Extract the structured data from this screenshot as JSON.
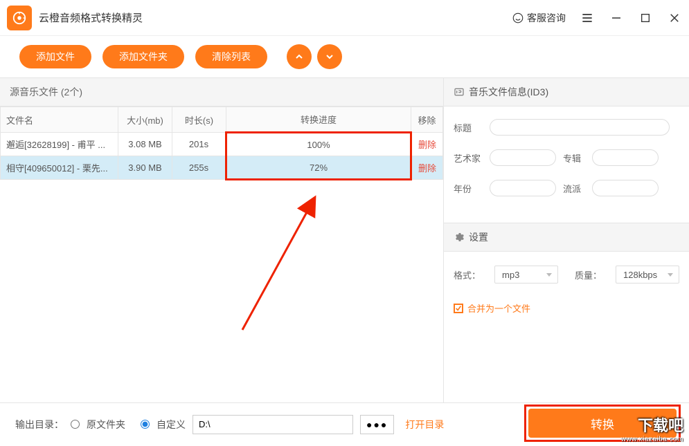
{
  "app": {
    "title": "云橙音频格式转换精灵",
    "kefu": "客服咨询"
  },
  "toolbar": {
    "add_file": "添加文件",
    "add_folder": "添加文件夹",
    "clear_list": "清除列表"
  },
  "files": {
    "panel_title": "源音乐文件 (2个)",
    "headers": {
      "name": "文件名",
      "size": "大小(mb)",
      "duration": "时长(s)",
      "progress": "转换进度",
      "remove": "移除"
    },
    "rows": [
      {
        "name": "邂逅[32628199] - 甫平 ...",
        "size": "3.08 MB",
        "duration": "201s",
        "progress": "100%",
        "del": "删除",
        "selected": false
      },
      {
        "name": "相守[409650012] - 栗先...",
        "size": "3.90 MB",
        "duration": "255s",
        "progress": "72%",
        "del": "删除",
        "selected": true
      }
    ]
  },
  "id3": {
    "section_title": "音乐文件信息(ID3)",
    "labels": {
      "title": "标题",
      "artist": "艺术家",
      "album": "专辑",
      "year": "年份",
      "genre": "流派"
    },
    "values": {
      "title": "",
      "artist": "",
      "album": "",
      "year": "",
      "genre": ""
    }
  },
  "settings": {
    "section_title": "设置",
    "format_label": "格式：",
    "format_value": "mp3",
    "quality_label": "质量：",
    "quality_value": "128kbps",
    "merge_label": "合并为一个文件"
  },
  "output": {
    "label": "输出目录：",
    "source_folder": "原文件夹",
    "custom": "自定义",
    "path": "D:\\",
    "open_dir": "打开目录"
  },
  "convert_btn": "转换",
  "watermark": {
    "big": "下载吧",
    "small": "www.xiazaiba.com"
  }
}
